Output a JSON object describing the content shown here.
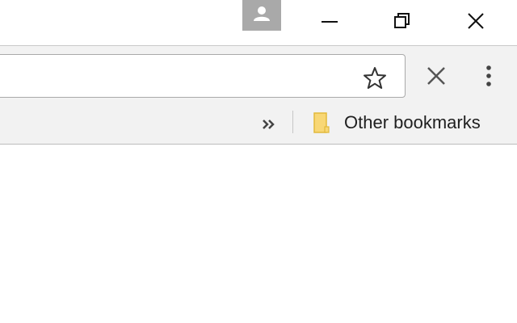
{
  "window": {
    "profile_icon": "person-icon",
    "minimize_icon": "minimize-icon",
    "maximize_icon": "restore-icon",
    "close_icon": "close-icon"
  },
  "toolbar": {
    "star_icon": "star-outline-icon",
    "stop_icon": "close-x-icon",
    "menu_icon": "vertical-dots-icon"
  },
  "bookmarks_bar": {
    "overflow_icon": "double-chevron-right-icon",
    "other_bookmarks_label": "Other bookmarks",
    "folder_icon": "folder-icon",
    "folder_color": "#f8d775"
  },
  "colors": {
    "toolbar_bg": "#f2f2f2",
    "profile_bg": "#a9a9a9"
  }
}
